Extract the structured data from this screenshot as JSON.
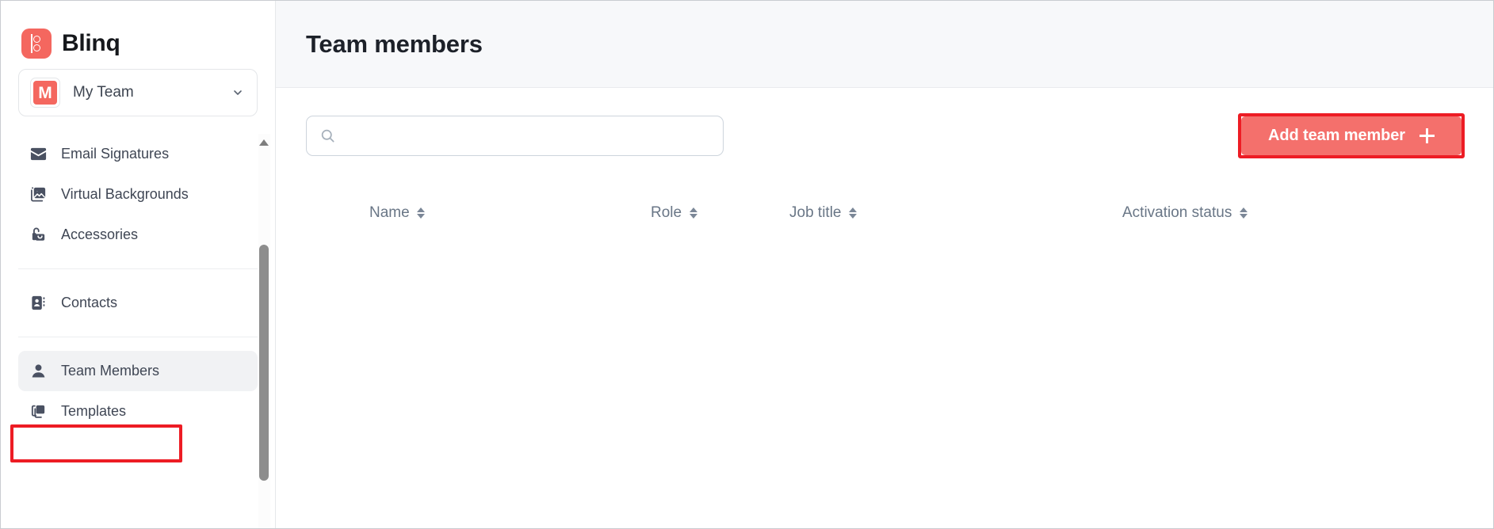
{
  "brand": {
    "name": "Blinq",
    "logo_icon": "blinq-logo-icon",
    "logo_color": "#f4675f"
  },
  "team_selector": {
    "avatar_initial": "M",
    "avatar_color": "#f4675f",
    "name": "My Team",
    "chevron_icon": "chevron-down-icon"
  },
  "sidebar": {
    "groups": [
      {
        "items": [
          {
            "label": "Email Signatures",
            "icon": "envelope-icon",
            "active": false
          },
          {
            "label": "Virtual Backgrounds",
            "icon": "image-icon",
            "active": false
          },
          {
            "label": "Accessories",
            "icon": "bag-icon",
            "active": false
          }
        ]
      },
      {
        "items": [
          {
            "label": "Contacts",
            "icon": "contact-book-icon",
            "active": false
          }
        ]
      },
      {
        "items": [
          {
            "label": "Team Members",
            "icon": "person-icon",
            "active": true
          },
          {
            "label": "Templates",
            "icon": "copy-icon",
            "active": false
          }
        ]
      }
    ],
    "scrollbar": {
      "up_arrow_icon": "scroll-up-arrow-icon"
    }
  },
  "header": {
    "title": "Team members"
  },
  "toolbar": {
    "search": {
      "icon": "search-icon",
      "value": "",
      "placeholder": ""
    },
    "add_button": {
      "label": "Add team member",
      "icon": "plus-icon",
      "bg_color": "#f4706c",
      "text_color": "#ffffff"
    }
  },
  "table": {
    "columns": [
      {
        "label": "Name",
        "sort_icon": "sort-arrows-icon"
      },
      {
        "label": "Role",
        "sort_icon": "sort-arrows-icon"
      },
      {
        "label": "Job title",
        "sort_icon": "sort-arrows-icon"
      },
      {
        "label": "Activation status",
        "sort_icon": "sort-arrows-icon"
      }
    ],
    "rows": []
  },
  "annotations": {
    "highlight_color": "#ed1c24",
    "boxes": [
      "team-members-nav-item",
      "add-team-member-button"
    ]
  }
}
